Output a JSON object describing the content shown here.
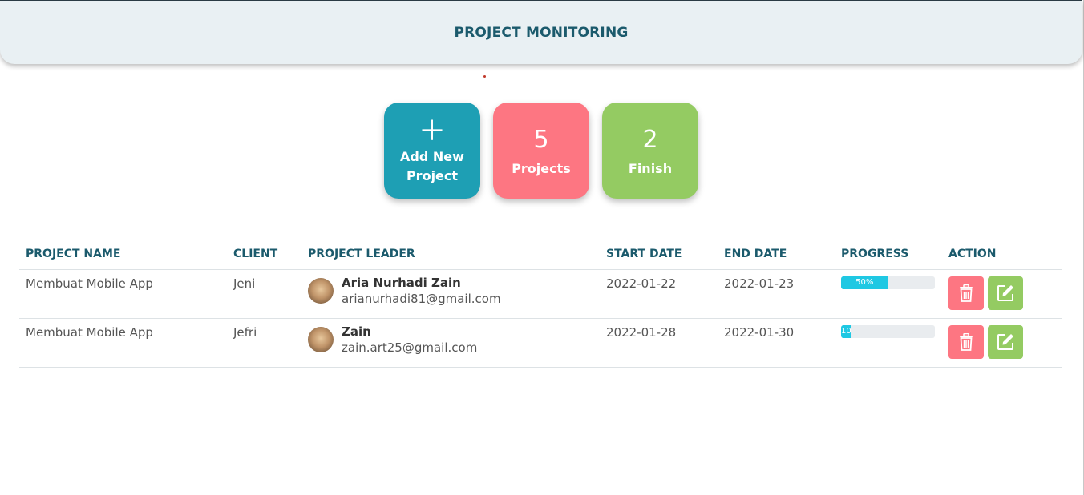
{
  "header": {
    "title": "PROJECT MONITORING"
  },
  "cards": {
    "add": {
      "plus": "+",
      "label": "Add New Project"
    },
    "projects": {
      "count": "5",
      "label": "Projects"
    },
    "finish": {
      "count": "2",
      "label": "Finish"
    }
  },
  "table": {
    "columns": [
      "PROJECT NAME",
      "CLIENT",
      "PROJECT LEADER",
      "START DATE",
      "END DATE",
      "PROGRESS",
      "ACTION"
    ],
    "rows": [
      {
        "project_name": "Membuat Mobile App",
        "client": "Jeni",
        "leader_name": "Aria Nurhadi Zain",
        "leader_email": "arianurhadi81@gmail.com",
        "start_date": "2022-01-22",
        "end_date": "2022-01-23",
        "progress_label": "50%",
        "progress": 50
      },
      {
        "project_name": "Membuat Mobile App",
        "client": "Jefri",
        "leader_name": "Zain",
        "leader_email": "zain.art25@gmail.com",
        "start_date": "2022-01-28",
        "end_date": "2022-01-30",
        "progress_label": "10",
        "progress": 10
      }
    ]
  },
  "icons": {
    "delete": "trash-icon",
    "edit": "edit-icon"
  },
  "colors": {
    "primary": "#1e9fb4",
    "danger": "#fd7682",
    "success": "#94cb62",
    "heading": "#1b5a6c",
    "progress": "#1fc8e3"
  }
}
